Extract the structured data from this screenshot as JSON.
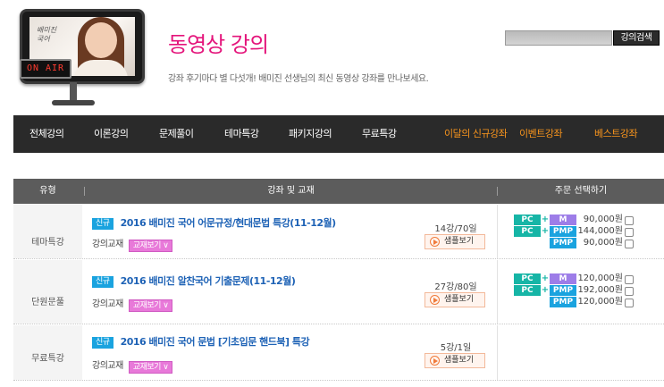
{
  "header": {
    "title": "동영상 강의",
    "subtitle": "강좌 후기마다 별 다섯개! 배미진 선생님의 최신 동영상 강좌를 만나보세요.",
    "onair": "ON AIR",
    "tv_sign": "배미진 국어",
    "search_placeholder": "",
    "search_button": "강의검색"
  },
  "nav": {
    "items": [
      {
        "label": "전체강의",
        "highlight": false
      },
      {
        "label": "이론강의",
        "highlight": false
      },
      {
        "label": "문제풀이",
        "highlight": false
      },
      {
        "label": "테마특강",
        "highlight": false
      },
      {
        "label": "패키지강의",
        "highlight": false
      },
      {
        "label": "무료특강",
        "highlight": false
      },
      {
        "label": "이달의 신규강좌",
        "highlight": true
      },
      {
        "label": "이벤트강좌",
        "highlight": true
      },
      {
        "label": "베스트강좌",
        "highlight": true
      }
    ]
  },
  "table": {
    "headers": {
      "type": "유형",
      "course": "강좌 및 교재",
      "order": "주문 선택하기"
    },
    "rows": [
      {
        "type": "테마특강",
        "badge": "신규",
        "title": "2016 배미진 국어 어문규정/현대문법 특강(11-12월)",
        "textbook_label": "강의교재",
        "textbook_button": "교재보기 ∨",
        "lectures": "14강/70일",
        "sample": "샘플보기",
        "prices": [
          {
            "tags": [
              "PC",
              "M"
            ],
            "amount": "90,000원"
          },
          {
            "tags": [
              "PC",
              "PMP"
            ],
            "amount": "144,000원"
          },
          {
            "tags": [
              "PMP"
            ],
            "amount": "90,000원"
          }
        ]
      },
      {
        "type": "단원문풀",
        "badge": "신규",
        "title": "2016 배미진 알찬국어 기출문제(11-12월)",
        "textbook_label": "강의교재",
        "textbook_button": "교재보기 ∨",
        "lectures": "27강/80일",
        "sample": "샘플보기",
        "prices": [
          {
            "tags": [
              "PC",
              "M"
            ],
            "amount": "120,000원"
          },
          {
            "tags": [
              "PC",
              "PMP"
            ],
            "amount": "192,000원"
          },
          {
            "tags": [
              "PMP"
            ],
            "amount": "120,000원"
          }
        ]
      },
      {
        "type": "무료특강",
        "badge": "신규",
        "title": "2016 배미진 국어 문법 [기초입문 핸드북] 특강",
        "textbook_label": "강의교재",
        "textbook_button": "교재보기 ∨",
        "lectures": "5강/1일",
        "sample": "샘플보기",
        "prices": []
      }
    ]
  },
  "colors": {
    "title_pink": "#e4147b",
    "nav_bg": "#2a2a2a",
    "nav_highlight": "#f7941d",
    "course_blue": "#1f63b6",
    "badge_blue": "#1aa3df",
    "pc_tag": "#16b5a6",
    "m_tag": "#9d7de8",
    "pmp_tag": "#1aa3df",
    "textbook_pink": "#e879d9"
  }
}
